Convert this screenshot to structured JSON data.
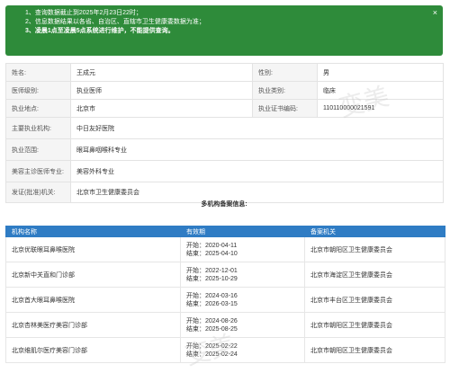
{
  "notice": {
    "lines": [
      "1、查询数据截止到2025年2月23日22时；",
      "2、信息数据结果以各省、自治区、直辖市卫生健康委数据为准；",
      "3、凌晨1点至凌晨5点系统进行维护，不能提供查询。"
    ],
    "close_icon": "×"
  },
  "info": {
    "name_label": "姓名:",
    "name_value": "王成元",
    "gender_label": "性别:",
    "gender_value": "男",
    "level_label": "医师级别:",
    "level_value": "执业医师",
    "category_label": "执业类别:",
    "category_value": "临床",
    "location_label": "执业地点:",
    "location_value": "北京市",
    "cert_label": "执业证书编码:",
    "cert_value": "110110000021591",
    "org_label": "主要执业机构:",
    "org_value": "中日友好医院",
    "scope_label": "执业范围:",
    "scope_value": "眼耳鼻咽喉科专业",
    "cosmetic_label": "美容主诊医师专业:",
    "cosmetic_value": "美容外科专业",
    "issuer_label": "发证(批准)机关:",
    "issuer_value": "北京市卫生健康委员会"
  },
  "records_title": "多机构备案信息:",
  "records": {
    "headers": [
      "机构名称",
      "有效期",
      "备案机关"
    ],
    "rows": [
      {
        "org": "北京优联眼耳鼻喉医院",
        "start": "开始：2020-04-11",
        "end": "结束：2025-04-10",
        "agency": "北京市朝阳区卫生健康委员会"
      },
      {
        "org": "北京新中关直和门诊部",
        "start": "开始：2022-12-01",
        "end": "结束：2025-10-29",
        "agency": "北京市海淀区卫生健康委员会"
      },
      {
        "org": "北京首大眼耳鼻喉医院",
        "start": "开始：2024-03-16",
        "end": "结束：2026-03-15",
        "agency": "北京市丰台区卫生健康委员会"
      },
      {
        "org": "北京杏林美医疗美容门诊部",
        "start": "开始：2024-08-26",
        "end": "结束：2025-08-25",
        "agency": "北京市朝阳区卫生健康委员会"
      },
      {
        "org": "北京维肌尔医疗美容门诊部",
        "start": "开始：2025-02-22",
        "end": "结束：2025-02-24",
        "agency": "北京市朝阳区卫生健康委员会"
      }
    ]
  },
  "watermark_text": "变美"
}
